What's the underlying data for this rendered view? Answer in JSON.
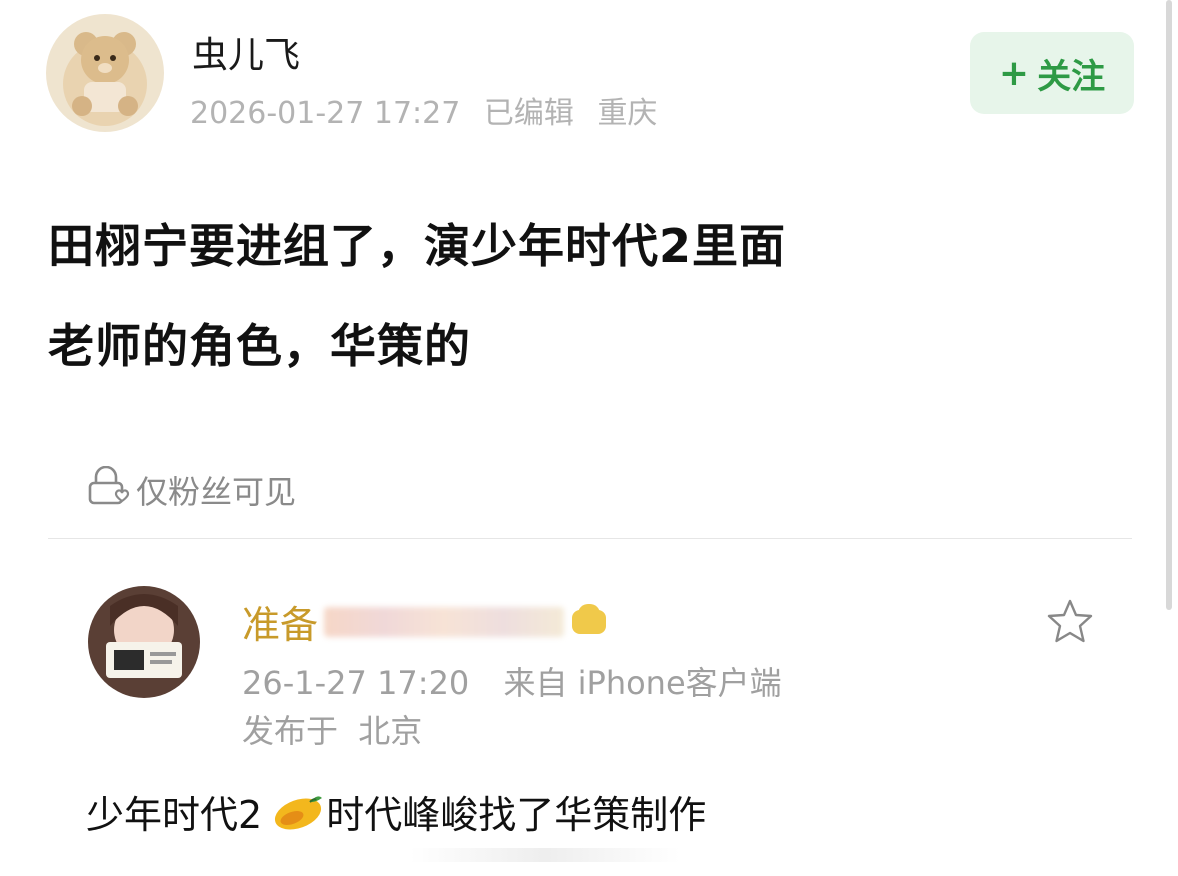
{
  "post": {
    "author": "虫儿飞",
    "timestamp": "2026-01-27 17:27",
    "edited": "已编辑",
    "location": "重庆",
    "follow_label": "关注",
    "follow_plus": "+",
    "text_line1": "田栩宁要进组了，演少年时代2里面",
    "text_line2": "老师的角色，华策的",
    "visibility": "仅粉丝可见"
  },
  "comment": {
    "name_visible": "准备",
    "timestamp": "26-1-27 17:20",
    "source": "来自 iPhone客户端",
    "published_label": "发布于",
    "location": "北京",
    "text_before": "少年时代2",
    "text_after": "时代峰峻找了华策制作"
  },
  "icons": {
    "lock_heart": "lock-heart-icon",
    "star": "star-outline-icon",
    "mango": "mango-emoji-icon"
  },
  "colors": {
    "follow_bg": "#e7f5ea",
    "follow_text": "#2e9a45",
    "comment_name": "#c89a2a",
    "meta_gray": "#b3b3b3"
  }
}
